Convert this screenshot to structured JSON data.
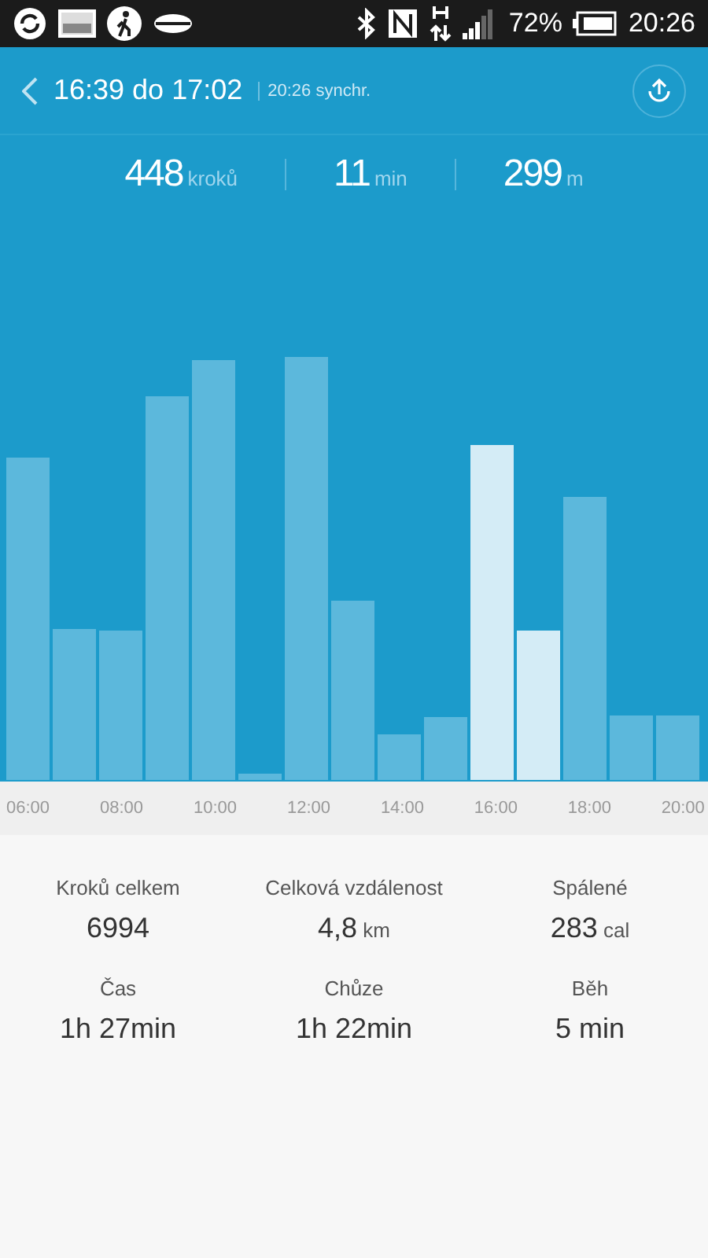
{
  "status_bar": {
    "battery": "72%",
    "time": "20:26"
  },
  "header": {
    "title": "16:39 do 17:02",
    "sync": "20:26 synchr."
  },
  "summary": [
    {
      "value": "448",
      "unit": "kroků"
    },
    {
      "value": "11",
      "unit": "min"
    },
    {
      "value": "299",
      "unit": "m"
    }
  ],
  "axis_labels": [
    "06:00",
    "08:00",
    "10:00",
    "12:00",
    "14:00",
    "16:00",
    "18:00",
    "20:00"
  ],
  "stats": [
    {
      "label": "Kroků celkem",
      "value": "6994"
    },
    {
      "label": "Celková vzdálenost",
      "value": "4,8",
      "unit": "km"
    },
    {
      "label": "Spálené",
      "value": "283",
      "unit": "cal"
    },
    {
      "label": "Čas",
      "value": "1h 27min"
    },
    {
      "label": "Chůze",
      "value": "1h 22min"
    },
    {
      "label": "Běh",
      "value": "5 min"
    }
  ]
}
